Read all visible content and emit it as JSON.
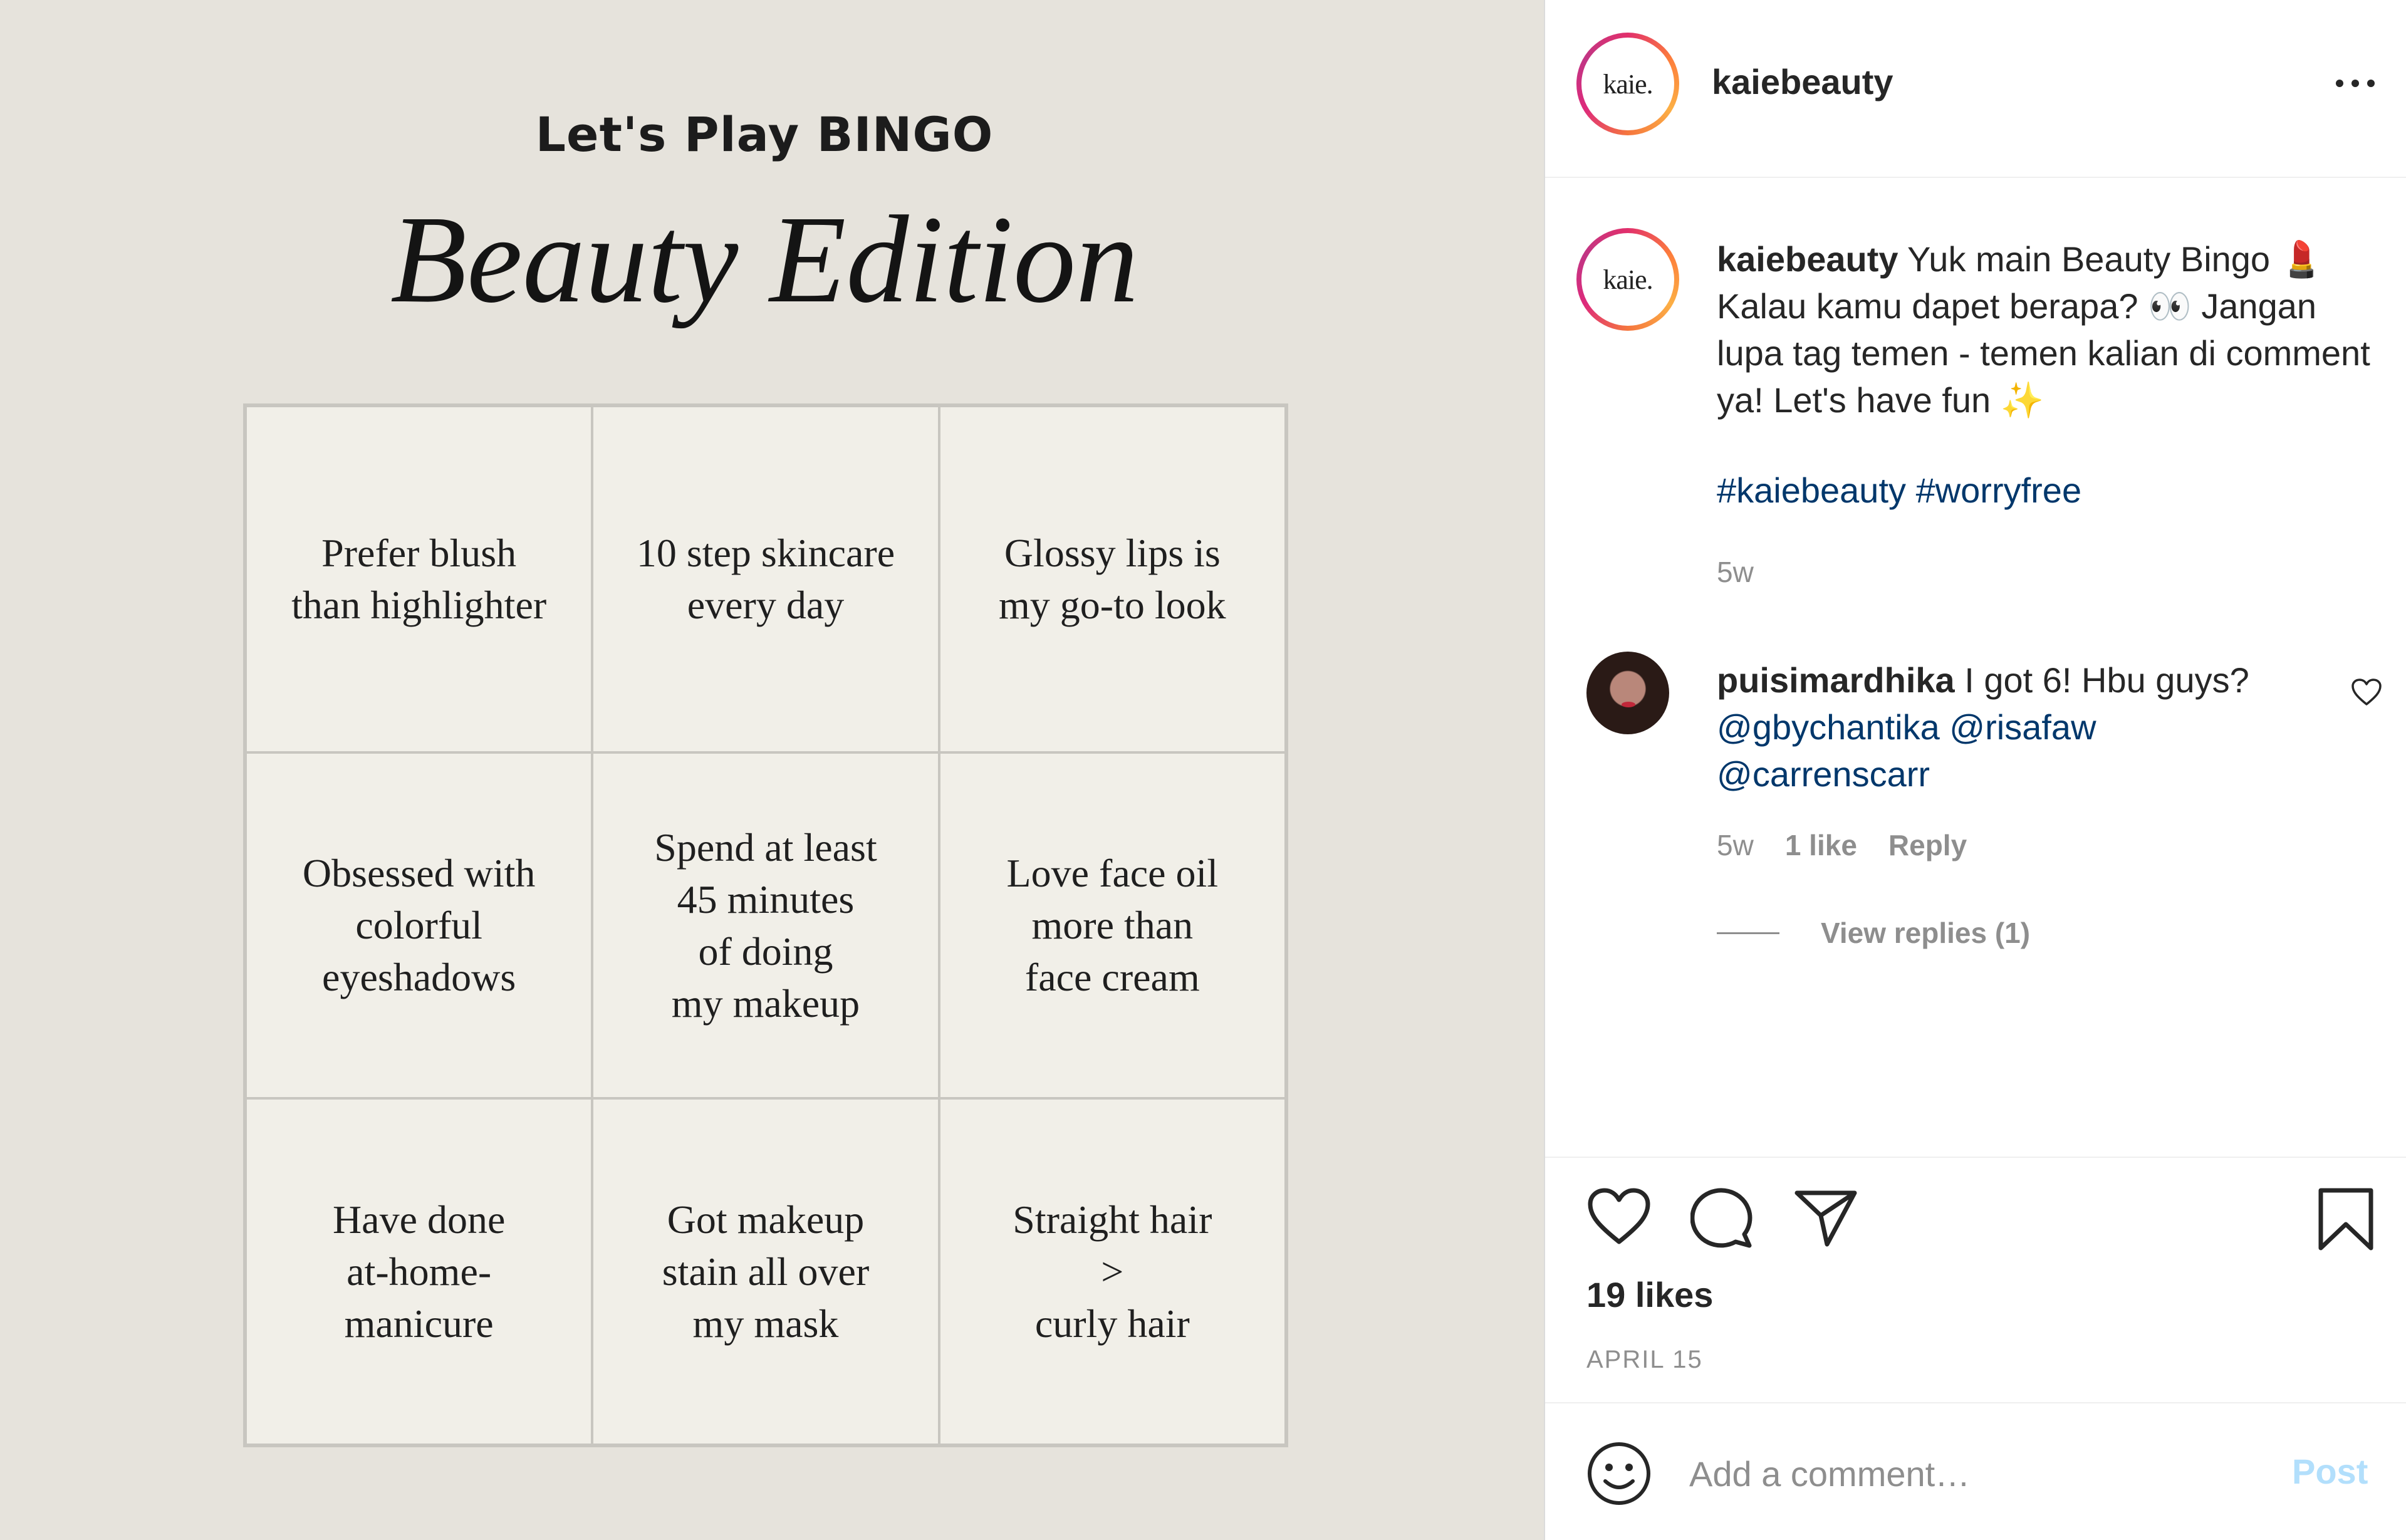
{
  "post_image": {
    "kicker": "Let's Play BINGO",
    "title": "Beauty Edition",
    "cells": [
      "Prefer blush\nthan highlighter",
      "10 step skincare\nevery day",
      "Glossy lips is\nmy go-to look",
      "Obsessed with\ncolorful\neyeshadows",
      "Spend at least\n45 minutes\nof doing\nmy makeup",
      "Love face oil\nmore than\nface cream",
      "Have done\nat-home-\nmanicure",
      "Got makeup\nstain all over\nmy mask",
      "Straight hair\n>\ncurly hair"
    ]
  },
  "header": {
    "avatar_logo": "kaie.",
    "username": "kaiebeauty",
    "more_icon": "more-horizontal-icon"
  },
  "caption": {
    "avatar_logo": "kaie.",
    "username": "kaiebeauty",
    "text": " Yuk main Beauty Bingo 💄 Kalau kamu dapet berapa? 👀 Jangan lupa tag temen - temen kalian di comment ya! Let's have fun ✨",
    "hashtags": "#kaiebeauty #worryfree",
    "time": "5w"
  },
  "comment": {
    "username": "puisimardhika",
    "text": " I got 6! Hbu guys? ",
    "mentions": [
      "@gbychantika",
      "@risafaw",
      "@carrenscarr"
    ],
    "time": "5w",
    "likes": "1 like",
    "reply_label": "Reply",
    "view_replies": "View replies (1)"
  },
  "actions": {
    "icons": [
      "heart-icon",
      "comment-icon",
      "share-icon",
      "bookmark-icon"
    ],
    "likes": "19 likes",
    "date": "APRIL 15"
  },
  "comment_bar": {
    "placeholder": "Add a comment…",
    "post_label": "Post"
  },
  "colors": {
    "image_bg": "#e6e3dc",
    "grid_bg": "#f1efe8",
    "link": "#00376b",
    "muted": "#8e8e8e",
    "post_disabled": "#b2dffc"
  }
}
